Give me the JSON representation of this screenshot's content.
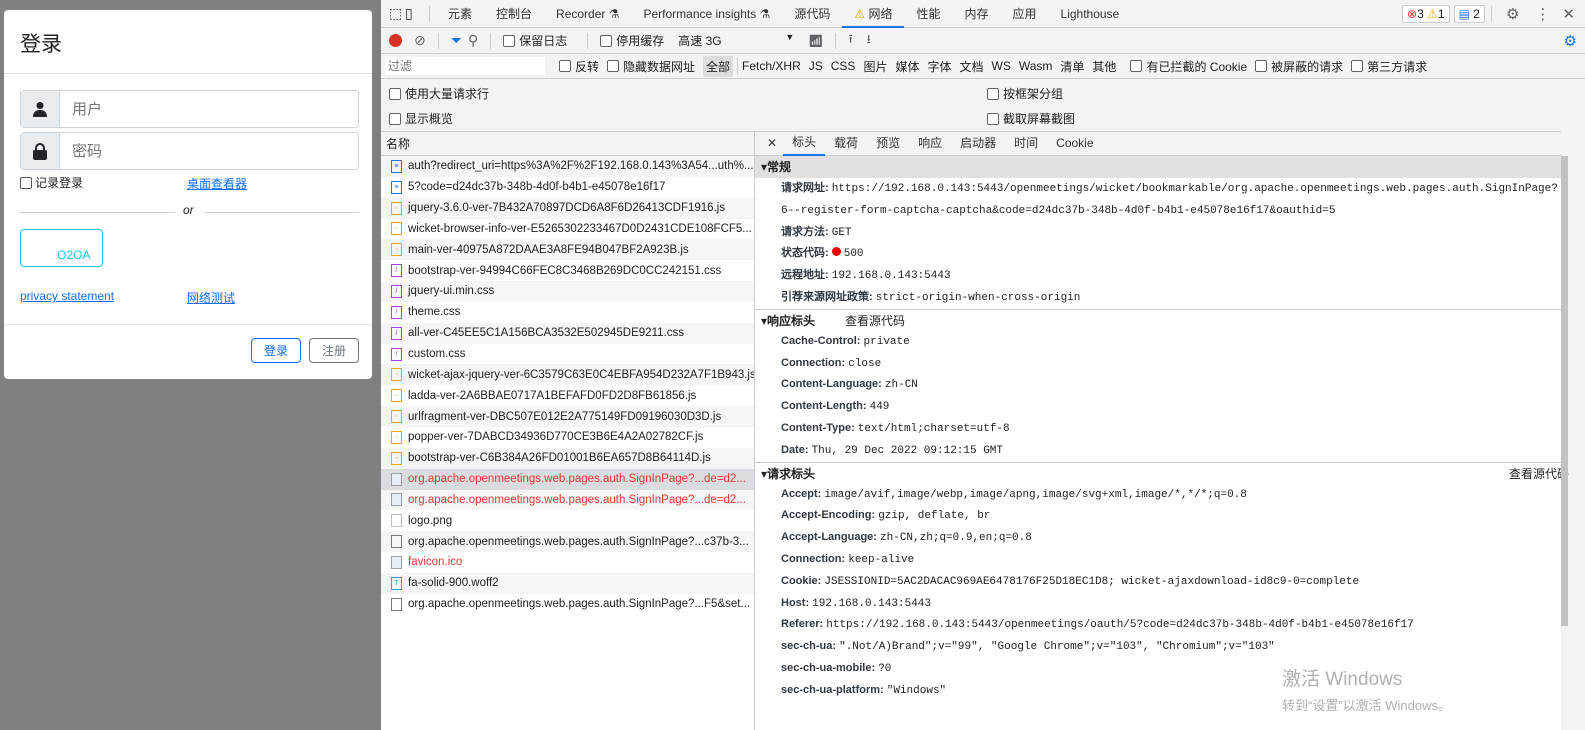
{
  "login": {
    "title": "登录",
    "user_placeholder": "用户",
    "password_placeholder": "密码",
    "remember": "记录登录",
    "desktop_viewer": "桌面查看器",
    "or": "or",
    "oauth_button": "O2OA",
    "privacy": "privacy statement",
    "network_test": "网络测试",
    "login_button": "登录",
    "register_button": "注册"
  },
  "devtools": {
    "tabs": [
      "元素",
      "控制台",
      "Recorder",
      "Performance insights",
      "源代码",
      "网络",
      "性能",
      "内存",
      "应用",
      "Lighthouse"
    ],
    "badges": {
      "errors": "3",
      "warnings": "1",
      "messages": "2"
    },
    "toolbar": {
      "preserve_log": "保留日志",
      "disable_cache": "停用缓存",
      "throttle": "高速 3G"
    },
    "filter": {
      "placeholder": "过滤",
      "invert": "反转",
      "hide_data_urls": "隐藏数据网址",
      "types": [
        "全部",
        "Fetch/XHR",
        "JS",
        "CSS",
        "图片",
        "媒体",
        "字体",
        "文档",
        "WS",
        "Wasm",
        "清单",
        "其他"
      ],
      "blocked_cookies": "有已拦截的 Cookie",
      "blocked_requests": "被屏蔽的请求",
      "third_party": "第三方请求"
    },
    "options": {
      "big_rows": "使用大量请求行",
      "group_by_frame": "按框架分组",
      "overview": "显示概览",
      "screenshots": "截取屏幕截图"
    },
    "list_header": "名称",
    "requests": [
      {
        "name": "auth?redirect_uri=https%3A%2F%2F192.168.0.143%3A54...uth%...",
        "type": "doc",
        "error": false
      },
      {
        "name": "5?code=d24dc37b-348b-4d0f-b4b1-e45078e16f17",
        "type": "doc",
        "error": false
      },
      {
        "name": "jquery-3.6.0-ver-7B432A70897DCD6A8F6D26413CDF1916.js",
        "type": "js",
        "error": false
      },
      {
        "name": "wicket-browser-info-ver-E5265302233467D0D2431CDE108FCF5...",
        "type": "js",
        "error": false
      },
      {
        "name": "main-ver-40975A872DAAE3A8FE94B047BF2A923B.js",
        "type": "js",
        "error": false
      },
      {
        "name": "bootstrap-ver-94994C66FEC8C3468B269DC0CC242151.css",
        "type": "css",
        "error": false
      },
      {
        "name": "jquery-ui.min.css",
        "type": "css",
        "error": false
      },
      {
        "name": "theme.css",
        "type": "css",
        "error": false
      },
      {
        "name": "all-ver-C45EE5C1A156BCA3532E502945DE9211.css",
        "type": "css",
        "error": false
      },
      {
        "name": "custom.css",
        "type": "css",
        "error": false
      },
      {
        "name": "wicket-ajax-jquery-ver-6C3579C63E0C4EBFA954D232A7F1B943.js",
        "type": "js",
        "error": false
      },
      {
        "name": "ladda-ver-2A6BBAE0717A1BEFAFD0FD2D8FB61856.js",
        "type": "js",
        "error": false
      },
      {
        "name": "urlfragment-ver-DBC507E012E2A775149FD09196030D3D.js",
        "type": "js",
        "error": false
      },
      {
        "name": "popper-ver-7DABCD34936D770CE3B6E4A2A02782CF.js",
        "type": "js",
        "error": false
      },
      {
        "name": "bootstrap-ver-C6B384A26FD01001B6EA657D8B64114D.js",
        "type": "js",
        "error": false
      },
      {
        "name": "org.apache.openmeetings.web.pages.auth.SignInPage?...de=d2...",
        "type": "img",
        "error": true,
        "selected": true
      },
      {
        "name": "org.apache.openmeetings.web.pages.auth.SignInPage?...de=d2...",
        "type": "img",
        "error": true
      },
      {
        "name": "logo.png",
        "type": "png",
        "error": false
      },
      {
        "name": "org.apache.openmeetings.web.pages.auth.SignInPage?...c37b-3...",
        "type": "other",
        "error": false
      },
      {
        "name": "favicon.ico",
        "type": "img",
        "error": true
      },
      {
        "name": "fa-solid-900.woff2",
        "type": "font",
        "error": false
      },
      {
        "name": "org.apache.openmeetings.web.pages.auth.SignInPage?...F5&set...",
        "type": "other",
        "error": false
      }
    ],
    "detail_tabs": [
      "标头",
      "载荷",
      "预览",
      "响应",
      "启动器",
      "时间",
      "Cookie"
    ],
    "general": {
      "title": "常规",
      "rows": [
        {
          "k": "请求网址:",
          "v": "https://192.168.0.143:5443/openmeetings/wicket/bookmarkable/org.apache.openmeetings.web.pages.auth.SignInPage?"
        },
        {
          "k": "",
          "v": "6--register-form-captcha-captcha&code=d24dc37b-348b-4d0f-b4b1-e45078e16f17&oauthid=5"
        },
        {
          "k": "请求方法:",
          "v": "GET"
        },
        {
          "k": "状态代码:",
          "v": "500",
          "status": true
        },
        {
          "k": "远程地址:",
          "v": "192.168.0.143:5443"
        },
        {
          "k": "引荐来源网址政策:",
          "v": "strict-origin-when-cross-origin"
        }
      ]
    },
    "response_headers": {
      "title": "响应标头",
      "view_source": "查看源代码",
      "rows": [
        {
          "k": "Cache-Control:",
          "v": "private"
        },
        {
          "k": "Connection:",
          "v": "close"
        },
        {
          "k": "Content-Language:",
          "v": "zh-CN"
        },
        {
          "k": "Content-Length:",
          "v": "449"
        },
        {
          "k": "Content-Type:",
          "v": "text/html;charset=utf-8"
        },
        {
          "k": "Date:",
          "v": "Thu, 29 Dec 2022 09:12:15 GMT"
        }
      ]
    },
    "request_headers": {
      "title": "请求标头",
      "view_source": "查看源代码",
      "rows": [
        {
          "k": "Accept:",
          "v": "image/avif,image/webp,image/apng,image/svg+xml,image/*,*/*;q=0.8"
        },
        {
          "k": "Accept-Encoding:",
          "v": "gzip, deflate, br"
        },
        {
          "k": "Accept-Language:",
          "v": "zh-CN,zh;q=0.9,en;q=0.8"
        },
        {
          "k": "Connection:",
          "v": "keep-alive"
        },
        {
          "k": "Cookie:",
          "v": "JSESSIONID=5AC2DACAC969AE6478176F25D18EC1D8; wicket-ajaxdownload-id8c9-0=complete"
        },
        {
          "k": "Host:",
          "v": "192.168.0.143:5443"
        },
        {
          "k": "Referer:",
          "v": "https://192.168.0.143:5443/openmeetings/oauth/5?code=d24dc37b-348b-4d0f-b4b1-e45078e16f17"
        },
        {
          "k": "sec-ch-ua:",
          "v": "\".Not/A)Brand\";v=\"99\", \"Google Chrome\";v=\"103\", \"Chromium\";v=\"103\""
        },
        {
          "k": "sec-ch-ua-mobile:",
          "v": "?0"
        },
        {
          "k": "sec-ch-ua-platform:",
          "v": "\"Windows\""
        }
      ]
    }
  },
  "watermark": {
    "line1": "激活 Windows",
    "line2": "转到“设置”以激活 Windows。"
  }
}
